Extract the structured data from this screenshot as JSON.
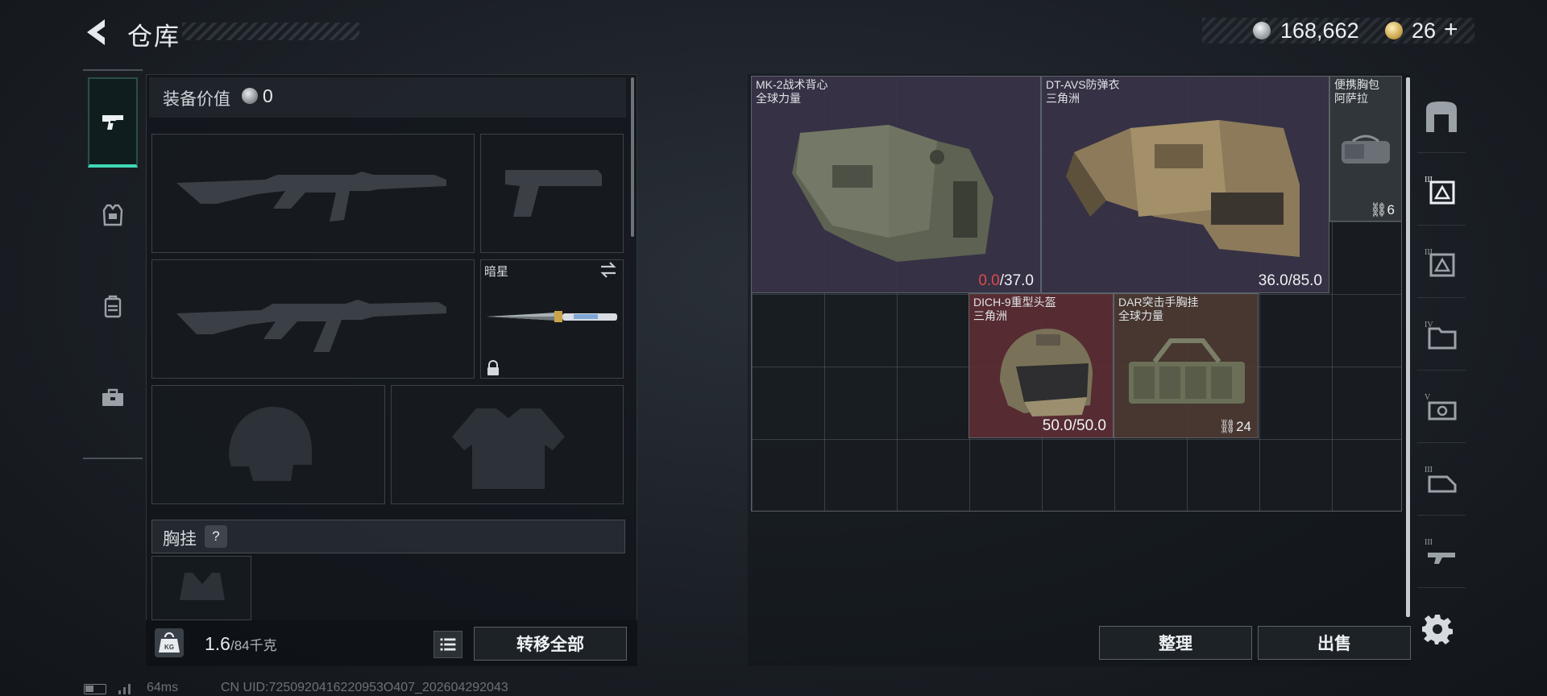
{
  "header": {
    "title": "仓库",
    "silver_amount": "168,662",
    "gold_amount": "26",
    "plus_label": "+"
  },
  "left_panel": {
    "equip_value_label": "装备价值",
    "equip_value": "0",
    "melee": {
      "name": "暗星"
    },
    "chest_rig_label": "胸挂",
    "help_label": "?",
    "weight": {
      "current": "1.6",
      "max_unit": "/84千克",
      "icon_label": "KG"
    },
    "transfer_all_label": "转移全部"
  },
  "status": {
    "ping": "64ms",
    "uid": "CN UID:7250920416220953O407_202604292043"
  },
  "inventory": {
    "items": [
      {
        "name": "MK-2战术背心",
        "origin": "全球力量",
        "dur_current": "0.0",
        "dur_max": "/37.0"
      },
      {
        "name": "DT-AVS防弹衣",
        "origin": "三角洲",
        "durability": "36.0/85.0"
      },
      {
        "name": "便携胸包",
        "origin": "阿萨拉",
        "count": "6"
      },
      {
        "name": "DICH-9重型头盔",
        "origin": "三角洲",
        "durability": "50.0/50.0"
      },
      {
        "name": "DAR突击手胸挂",
        "origin": "全球力量",
        "count": "24"
      }
    ],
    "sort_label": "整理",
    "sell_label": "出售"
  },
  "right_nav": {
    "tab_labels": [
      "III",
      "III",
      "IV",
      "V",
      "III",
      "III"
    ]
  },
  "colors": {
    "accent": "#40d8b8",
    "durability_low": "#e04a4a",
    "rarity_purple": "#3a3448",
    "rarity_gray": "#34383d",
    "rarity_red": "#5c2e34",
    "rarity_brown": "#4c3a32"
  }
}
